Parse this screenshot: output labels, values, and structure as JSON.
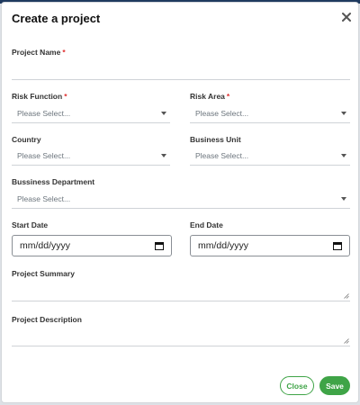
{
  "modal": {
    "title": "Create a project"
  },
  "fields": {
    "project_name": {
      "label": "Project Name",
      "required_mark": "*",
      "value": ""
    },
    "risk_function": {
      "label": "Risk Function",
      "required_mark": "*",
      "value": "Please Select..."
    },
    "risk_area": {
      "label": "Risk Area",
      "required_mark": "*",
      "value": "Please Select..."
    },
    "country": {
      "label": "Country",
      "value": "Please Select..."
    },
    "business_unit": {
      "label": "Business Unit",
      "value": "Please Select..."
    },
    "business_department": {
      "label": "Bussiness Department",
      "value": "Please Select..."
    },
    "start_date": {
      "label": "Start Date",
      "value": "mm/dd/yyyy"
    },
    "end_date": {
      "label": "End Date",
      "value": "mm/dd/yyyy"
    },
    "project_summary": {
      "label": "Project Summary",
      "value": ""
    },
    "project_description": {
      "label": "Project Description",
      "value": ""
    }
  },
  "buttons": {
    "close_label": "Close",
    "save_label": "Save"
  },
  "colors": {
    "accent": "#3fa447",
    "required": "#e03131",
    "top_strip": "#1f3a5f"
  },
  "icons": {
    "close": "close-icon",
    "dropdown": "chevron-down-icon",
    "calendar": "calendar-icon",
    "resize": "resize-grip-icon"
  }
}
